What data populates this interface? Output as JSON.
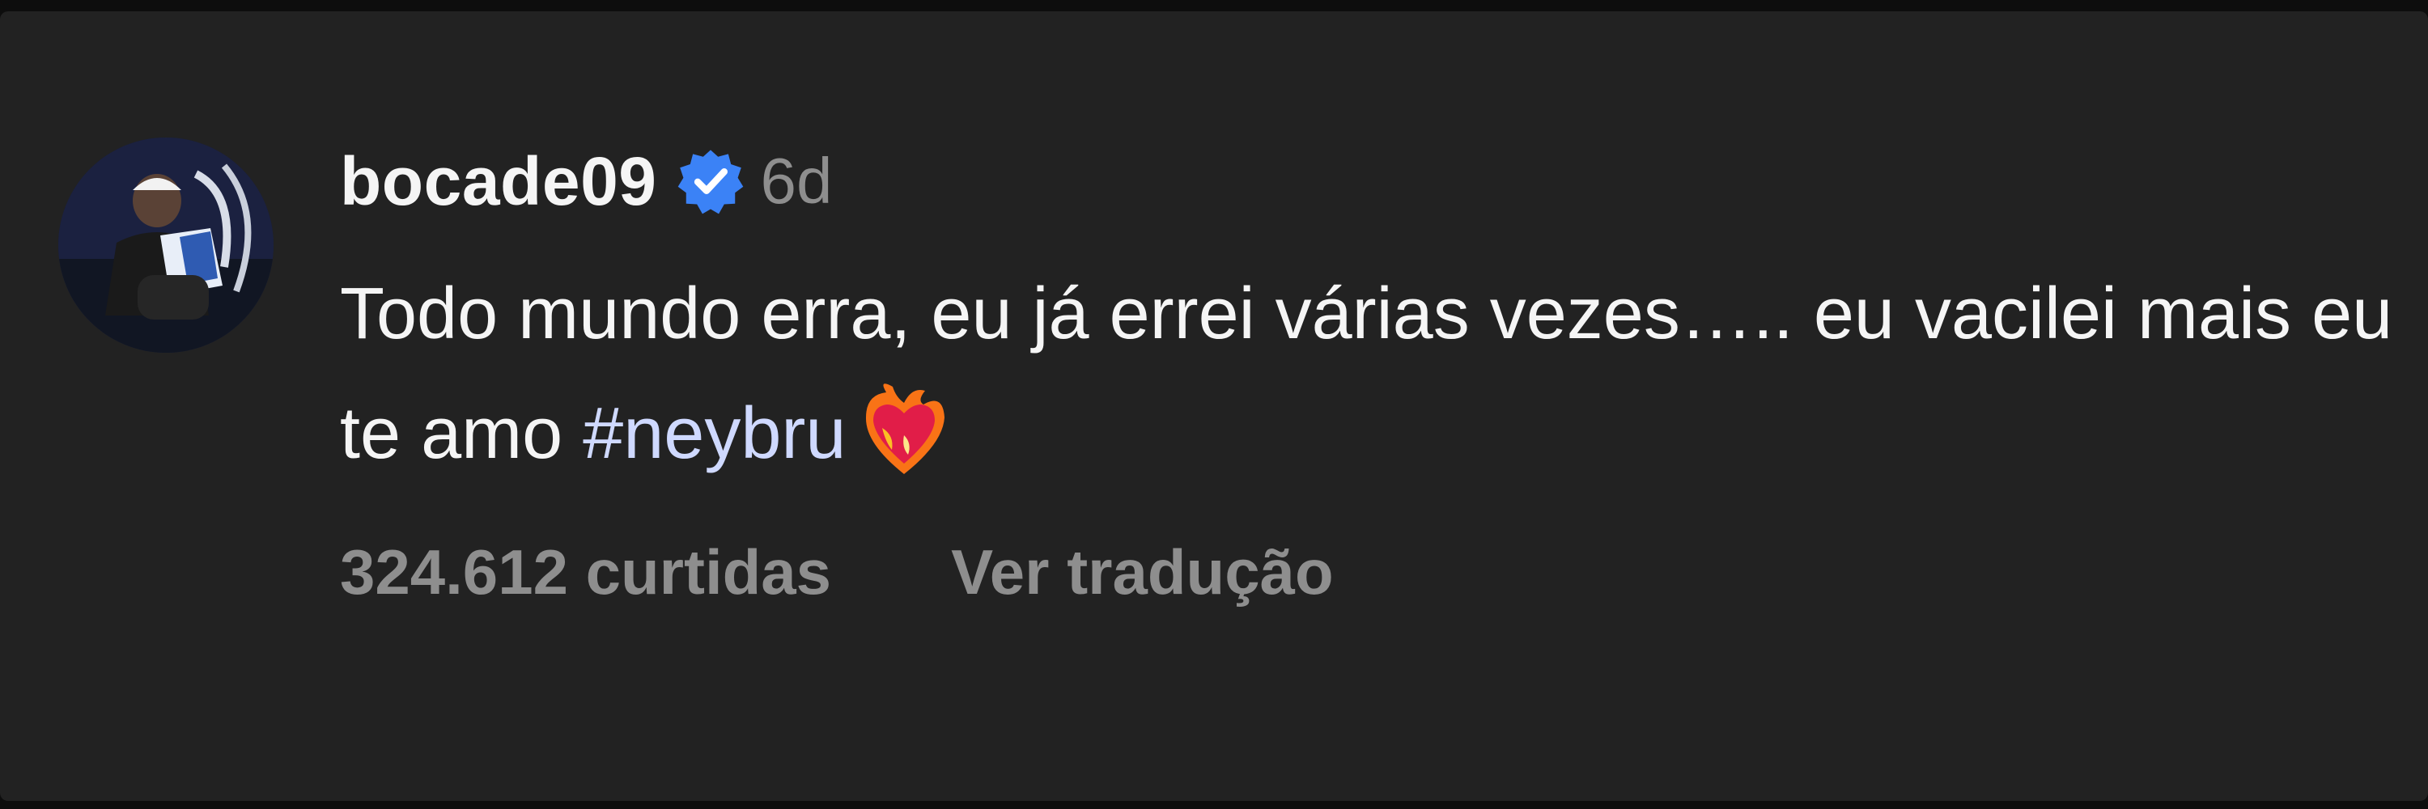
{
  "comment": {
    "username": "bocade09",
    "verified_icon": "verified-badge-icon",
    "timestamp": "6d",
    "caption": {
      "text": "Todo mundo erra, eu já errei várias vezes….. eu vacilei mais eu te amo ",
      "hashtag": "#neybru",
      "emoji_icon": "heart-on-fire-emoji"
    },
    "likes_label": "324.612 curtidas",
    "translate_label": "Ver tradução"
  },
  "colors": {
    "background": "#222222",
    "text_primary": "#f5f5f5",
    "text_secondary": "#8e8e8e",
    "verified_blue": "#3b82f6",
    "hashtag": "#cfd9ff"
  }
}
